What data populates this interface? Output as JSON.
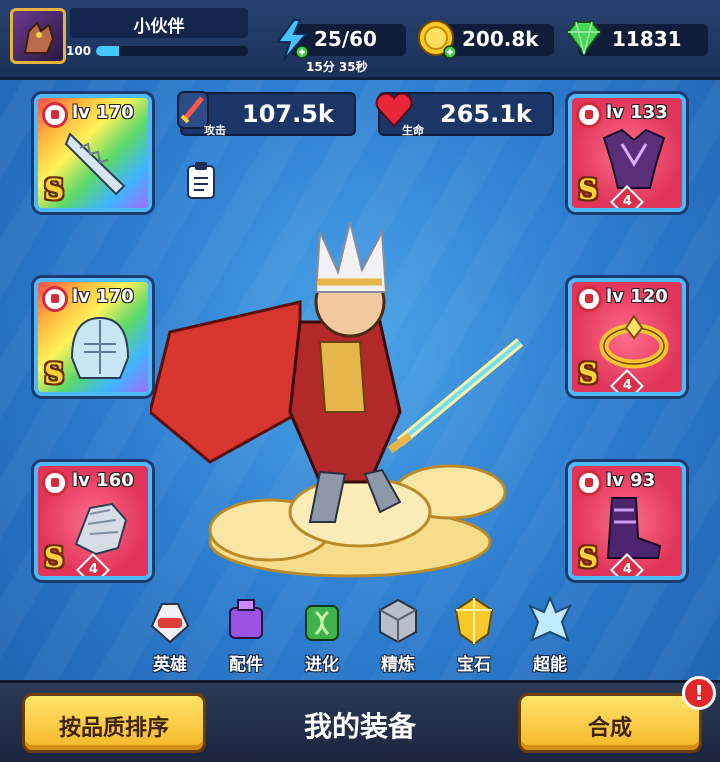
{
  "player": {
    "name": "小伙伴",
    "level": "100",
    "xp_progress": 0.15
  },
  "resources": {
    "energy": {
      "value": "25/60",
      "timer": "15分 35秒",
      "icon": "lightning-icon"
    },
    "gold": {
      "value": "200.8k",
      "icon": "gold-coin-icon"
    },
    "gems": {
      "value": "11831",
      "icon": "gem-icon"
    }
  },
  "stats": {
    "attack": {
      "value": "107.5k",
      "label": "攻击",
      "icon": "sword-icon"
    },
    "life": {
      "value": "265.1k",
      "label": "生命",
      "icon": "heart-icon"
    }
  },
  "equipment": [
    {
      "slot": "weapon",
      "level": "lv 170",
      "grade": "S",
      "stars": "",
      "frame": "rainbow"
    },
    {
      "slot": "helmet",
      "level": "lv 170",
      "grade": "S",
      "stars": "",
      "frame": "rainbow"
    },
    {
      "slot": "gloves",
      "level": "lv 160",
      "grade": "S",
      "stars": "4",
      "frame": "red"
    },
    {
      "slot": "armor",
      "level": "lv 133",
      "grade": "S",
      "stars": "4",
      "frame": "red"
    },
    {
      "slot": "ring",
      "level": "lv 120",
      "grade": "S",
      "stars": "4",
      "frame": "red"
    },
    {
      "slot": "boots",
      "level": "lv 93",
      "grade": "S",
      "stars": "4",
      "frame": "red"
    }
  ],
  "tabs": [
    {
      "label": "英雄",
      "icon": "hero-icon"
    },
    {
      "label": "配件",
      "icon": "accessory-icon"
    },
    {
      "label": "进化",
      "icon": "evolution-icon"
    },
    {
      "label": "精炼",
      "icon": "refine-icon"
    },
    {
      "label": "宝石",
      "icon": "gemstone-icon"
    },
    {
      "label": "超能",
      "icon": "superpower-icon"
    }
  ],
  "bottom": {
    "sort_button": "按品质排序",
    "title": "我的装备",
    "merge_button": "合成",
    "alert": "!"
  },
  "colors": {
    "gold_button": "#f5b728",
    "slot_border": "#4fb8ff",
    "red_frame": "#e13559"
  }
}
